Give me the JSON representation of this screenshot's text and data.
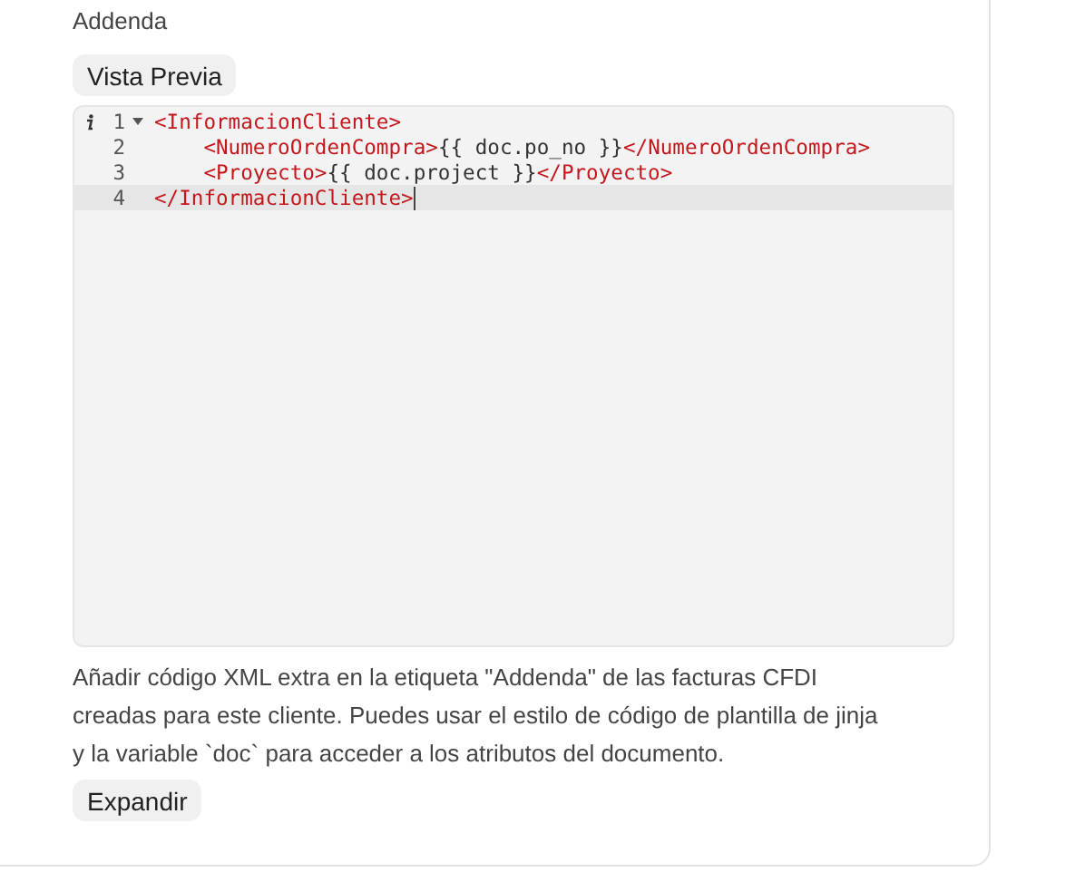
{
  "label": "Addenda",
  "preview_button": "Vista Previa",
  "editor": {
    "lines": [
      {
        "number": "1",
        "foldable": true,
        "info": true,
        "active": false,
        "segments": [
          {
            "kind": "tag",
            "text": "<InformacionCliente>"
          }
        ]
      },
      {
        "number": "2",
        "foldable": false,
        "info": false,
        "active": false,
        "segments": [
          {
            "kind": "tag",
            "text": "    <NumeroOrdenCompra>"
          },
          {
            "kind": "text",
            "text": "{{ doc.po_no }}"
          },
          {
            "kind": "tag",
            "text": "</NumeroOrdenCompra>"
          }
        ]
      },
      {
        "number": "3",
        "foldable": false,
        "info": false,
        "active": false,
        "segments": [
          {
            "kind": "tag",
            "text": "    <Proyecto>"
          },
          {
            "kind": "text",
            "text": "{{ doc.project }}"
          },
          {
            "kind": "tag",
            "text": "</Proyecto>"
          }
        ]
      },
      {
        "number": "4",
        "foldable": false,
        "info": false,
        "active": true,
        "segments": [
          {
            "kind": "tag",
            "text": "</InformacionCliente>"
          }
        ]
      }
    ]
  },
  "description": "Añadir código XML extra en la etiqueta \"Addenda\" de las facturas CFDI creadas para este cliente. Puedes usar el estilo de código de plantilla de jinja y la variable `doc` para acceder a los atributos del documento.",
  "expand_button": "Expandir"
}
